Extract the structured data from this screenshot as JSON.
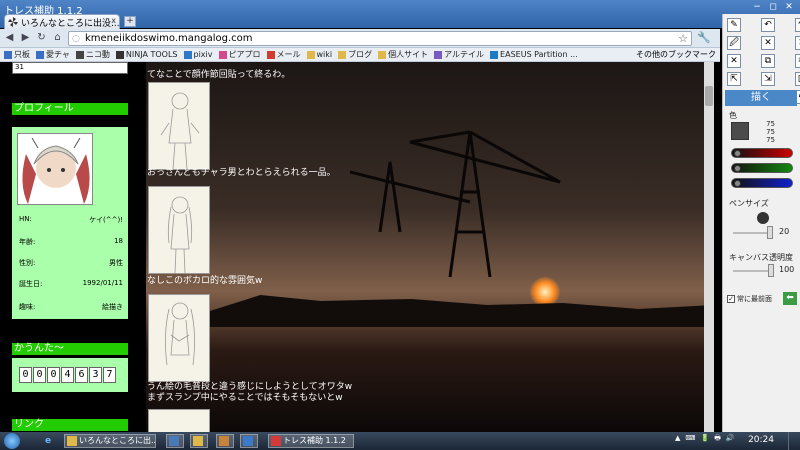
{
  "window": {
    "title": "トレス補助 1.1.2",
    "ctrl_min": "−",
    "ctrl_max": "◻",
    "ctrl_close": "✕"
  },
  "browser": {
    "tab_title": "いろんなところに出没...",
    "tab_close": "x",
    "new_tab": "+",
    "url": "kmeneiikdoswimo.mangalog.com",
    "nav_back": "◀",
    "nav_forward": "▶",
    "nav_reload": "↻",
    "nav_home": "⌂",
    "star": "☆",
    "wrench": "🔧",
    "bookmarks": [
      {
        "label": "只板",
        "color": "#3b6fc4"
      },
      {
        "label": "愛チャ",
        "color": "#3b6fc4"
      },
      {
        "label": "ニコ動",
        "color": "#444444"
      },
      {
        "label": "NINJA TOOLS",
        "color": "#333333"
      },
      {
        "label": "pixiv",
        "color": "#2f77c7"
      },
      {
        "label": "ピアプロ",
        "color": "#d34a8a"
      },
      {
        "label": "メール",
        "color": "#d33b2f"
      },
      {
        "label": "wiki",
        "color": "#e0b84a"
      },
      {
        "label": "ブログ",
        "color": "#e0b84a"
      },
      {
        "label": "個人サイト",
        "color": "#e0b84a"
      },
      {
        "label": "アルテイル",
        "color": "#7a5abf"
      },
      {
        "label": "EASEUS Partition ...",
        "color": "#1f7ac4"
      }
    ],
    "bookmarks_other": "その他のブックマーク"
  },
  "blog": {
    "top_box": "31",
    "profile_header": "プロフィール",
    "profile": [
      {
        "label": "HN:",
        "value": "ケイ(^^)!"
      },
      {
        "label": "年齢:",
        "value": "18"
      },
      {
        "label": "性別:",
        "value": "男性"
      },
      {
        "label": "誕生日:",
        "value": "1992/01/11"
      },
      {
        "label": "趣味:",
        "value": "絵描き"
      }
    ],
    "counter_header": "かうんた～",
    "counter_digits": [
      "0",
      "0",
      "0",
      "4",
      "6",
      "3",
      "7"
    ],
    "link_header": "リンク",
    "posts": [
      {
        "text": "てなことで顔作節回貼って終るわ。"
      },
      {
        "text": "おっさんどもチャラ男とわとらえられる一品。"
      },
      {
        "text": "なしこのボカロ的な雰囲気w"
      },
      {
        "text": "うん絵の毛普段と違う感じにしようとしてオワタw"
      },
      {
        "text": "まずスランプ中にやることではそもそもないとw"
      }
    ]
  },
  "paint": {
    "tools": [
      "✎",
      "↶",
      "↷",
      "🖉",
      "✕",
      "✕",
      "✕",
      "⧉",
      "✂",
      "⇱",
      "⇲",
      "▥",
      "📂",
      "💾",
      "⚙"
    ],
    "draw_button": "描く",
    "color_label": "色",
    "rgb": [
      "75",
      "75",
      "75"
    ],
    "color_current": "#4b4b4b",
    "bar_colors": [
      "#cc0000",
      "#118811",
      "#1122cc"
    ],
    "pen_size_label": "ペンサイズ",
    "pen_size": 20,
    "canvas_opacity_label": "キャンバス透明度",
    "canvas_opacity": 100,
    "always_on_top_label": "常に最前面",
    "always_on_top_checked": "✓",
    "go_icon": "⬅"
  },
  "taskbar": {
    "start": "start",
    "ie_icon": "e",
    "tasks": [
      {
        "label": "いろんなところに出...",
        "color": "#e0b84a"
      },
      {
        "label": "",
        "color": "#4a79b8"
      },
      {
        "label": "",
        "color": "#e0b84a"
      },
      {
        "label": "",
        "color": "#c8823a"
      },
      {
        "label": "",
        "color": "#3a7ac8"
      },
      {
        "label": "トレス補助 1.1.2",
        "color": "#d43a3a"
      }
    ],
    "tray": [
      "▲",
      "⌨",
      "🔋",
      "🖶",
      "🔊"
    ],
    "clock": "20:24"
  }
}
